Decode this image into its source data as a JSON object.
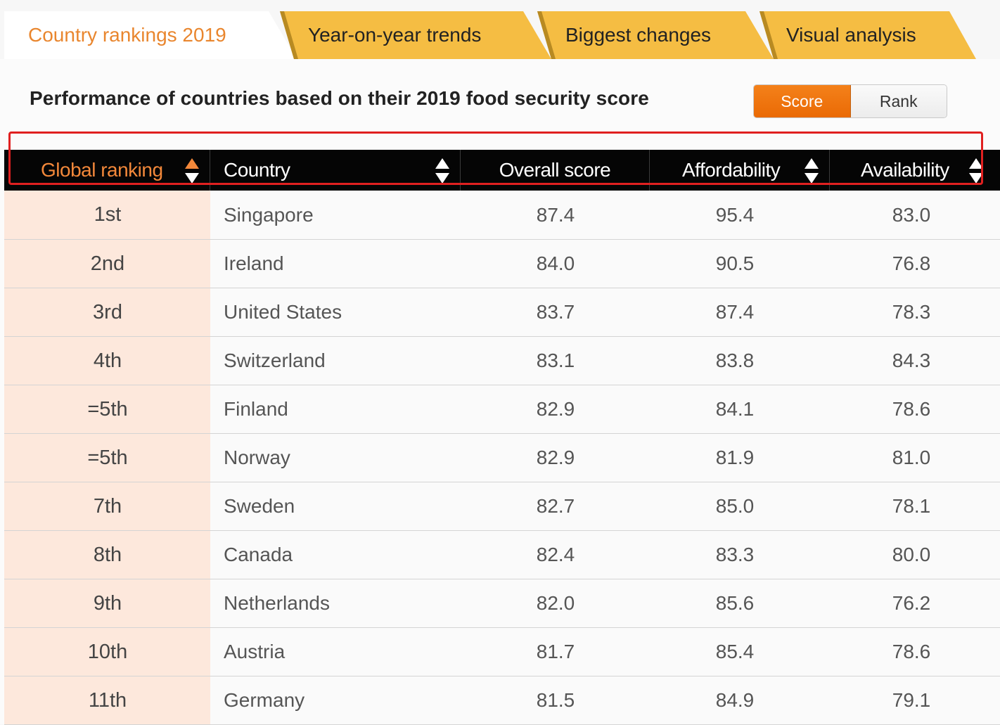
{
  "tabs": [
    {
      "label": "Country rankings 2019",
      "active": true
    },
    {
      "label": "Year-on-year trends",
      "active": false
    },
    {
      "label": "Biggest changes",
      "active": false
    },
    {
      "label": "Visual analysis",
      "active": false
    }
  ],
  "page_title": "Performance of countries based on their 2019 food security score",
  "toggle": {
    "score_label": "Score",
    "rank_label": "Rank",
    "selected": "Score"
  },
  "colors": {
    "accent_orange": "#ea7412",
    "tab_yellow": "#f5bd43",
    "header_black": "#050505",
    "rank_cell_bg": "#fde8dc",
    "highlight_red": "#e02020"
  },
  "table": {
    "headers": {
      "rank": "Global ranking",
      "country": "Country",
      "overall": "Overall score",
      "affordability": "Affordability",
      "availability": "Availability"
    },
    "sort_icons": [
      "sort-icon",
      "sort-icon",
      "sort-icon",
      "sort-icon"
    ],
    "rows": [
      {
        "rank": "1st",
        "country": "Singapore",
        "overall": "87.4",
        "affordability": "95.4",
        "availability": "83.0",
        "highlighted": true
      },
      {
        "rank": "2nd",
        "country": "Ireland",
        "overall": "84.0",
        "affordability": "90.5",
        "availability": "76.8"
      },
      {
        "rank": "3rd",
        "country": "United States",
        "overall": "83.7",
        "affordability": "87.4",
        "availability": "78.3"
      },
      {
        "rank": "4th",
        "country": "Switzerland",
        "overall": "83.1",
        "affordability": "83.8",
        "availability": "84.3"
      },
      {
        "rank": "=5th",
        "country": "Finland",
        "overall": "82.9",
        "affordability": "84.1",
        "availability": "78.6"
      },
      {
        "rank": "=5th",
        "country": "Norway",
        "overall": "82.9",
        "affordability": "81.9",
        "availability": "81.0"
      },
      {
        "rank": "7th",
        "country": "Sweden",
        "overall": "82.7",
        "affordability": "85.0",
        "availability": "78.1"
      },
      {
        "rank": "8th",
        "country": "Canada",
        "overall": "82.4",
        "affordability": "83.3",
        "availability": "80.0"
      },
      {
        "rank": "9th",
        "country": "Netherlands",
        "overall": "82.0",
        "affordability": "85.6",
        "availability": "76.2"
      },
      {
        "rank": "10th",
        "country": "Austria",
        "overall": "81.7",
        "affordability": "85.4",
        "availability": "78.6"
      },
      {
        "rank": "11th",
        "country": "Germany",
        "overall": "81.5",
        "affordability": "84.9",
        "availability": "79.1"
      }
    ]
  }
}
